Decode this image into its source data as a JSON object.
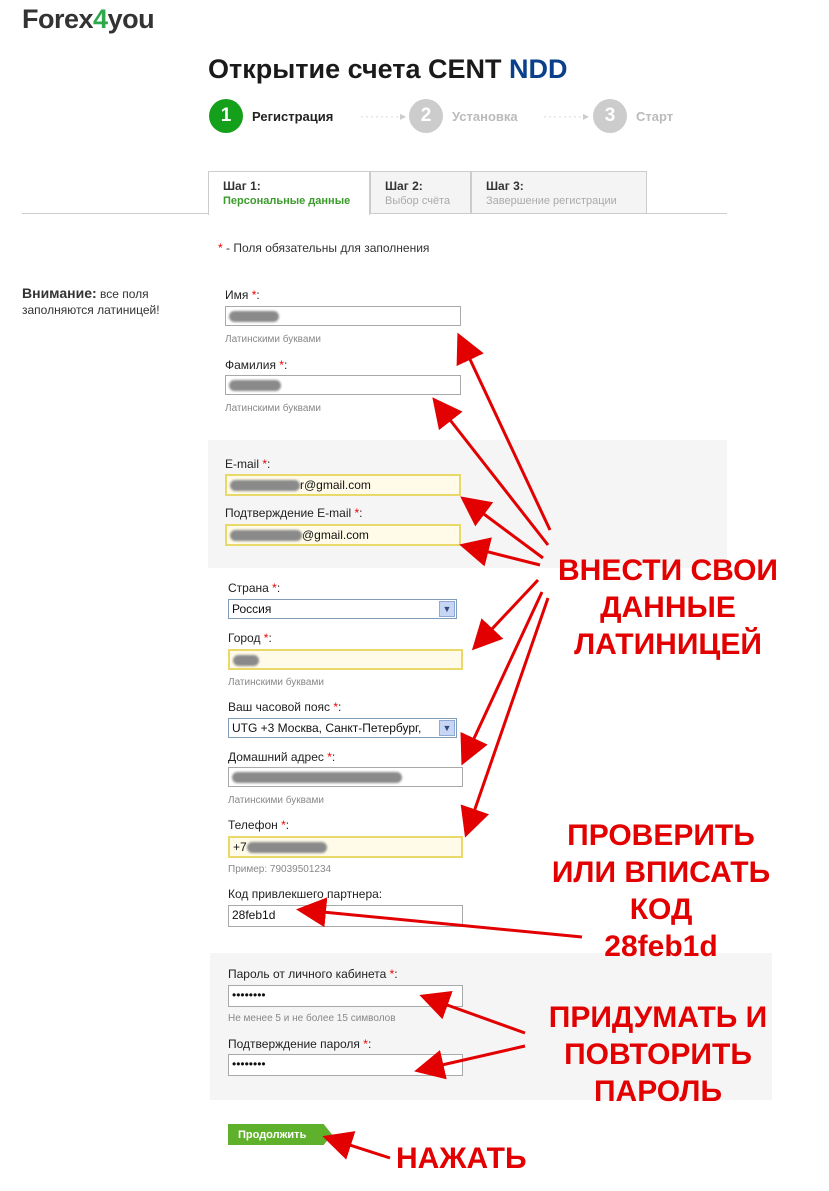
{
  "logo": {
    "part1": "Forex",
    "part2": "4",
    "part3": "you"
  },
  "header": {
    "title": "Открытие счета CENT",
    "title_accent": "NDD"
  },
  "steps": [
    {
      "num": "1",
      "label": "Регистрация",
      "color": "#14a01a"
    },
    {
      "num": "2",
      "label": "Установка",
      "color": "#cccccc"
    },
    {
      "num": "3",
      "label": "Старт",
      "color": "#cccccc"
    }
  ],
  "steps_sep": "········▸",
  "tabs": [
    {
      "title": "Шаг 1:",
      "subtitle": "Персональные данные"
    },
    {
      "title": "Шаг 2:",
      "subtitle": "Выбор счёта"
    },
    {
      "title": "Шаг 3:",
      "subtitle": "Завершение регистрации"
    }
  ],
  "required_note": {
    "star": "*",
    "text": " - Поля обязательны для заполнения"
  },
  "warning": {
    "bold": "Внимание:",
    "text": " все поля заполняются латиницей!"
  },
  "form": {
    "first_name": {
      "label": "Имя ",
      "hint": "Латинскими буквами"
    },
    "last_name": {
      "label": "Фамилия ",
      "hint": "Латинскими буквами"
    },
    "email": {
      "label": "E-mail ",
      "value_suffix": "r@gmail.com"
    },
    "email_confirm": {
      "label": "Подтверждение E-mail ",
      "value_suffix": "@gmail.com"
    },
    "country": {
      "label": "Страна ",
      "value": "Россия"
    },
    "city": {
      "label": "Город ",
      "hint": "Латинскими буквами"
    },
    "timezone": {
      "label": "Ваш часовой пояс ",
      "value": "UTG +3 Москва, Санкт-Петербург,"
    },
    "address": {
      "label": "Домашний адрес ",
      "hint": "Латинскими буквами"
    },
    "phone": {
      "label": "Телефон ",
      "value_prefix": "+7",
      "hint": "Пример: 79039501234"
    },
    "partner": {
      "label": "Код привлекшего партнера:",
      "value": "28feb1d"
    },
    "password": {
      "label": "Пароль от личного кабинета ",
      "value": "••••••••",
      "hint": "Не менее 5 и не более 15 символов"
    },
    "password_confirm": {
      "label": "Подтверждение пароля ",
      "value": "••••••••"
    },
    "required_star": "*",
    "colon": ":"
  },
  "submit_label": "Продолжить",
  "annotations": {
    "enter_data": [
      "ВНЕСТИ СВОИ",
      "ДАННЫЕ",
      "ЛАТИНИЦЕЙ"
    ],
    "check_code": [
      "ПРОВЕРИТЬ",
      "ИЛИ ВПИСАТЬ",
      "КОД",
      "28feb1d"
    ],
    "password": [
      "ПРИДУМАТЬ И",
      "ПОВТОРИТЬ",
      "ПАРОЛЬ"
    ],
    "press": "НАЖАТЬ"
  },
  "colors": {
    "annotation": "#e20000",
    "accent": "#0a3f8a",
    "brand_green": "#2ea84a"
  }
}
